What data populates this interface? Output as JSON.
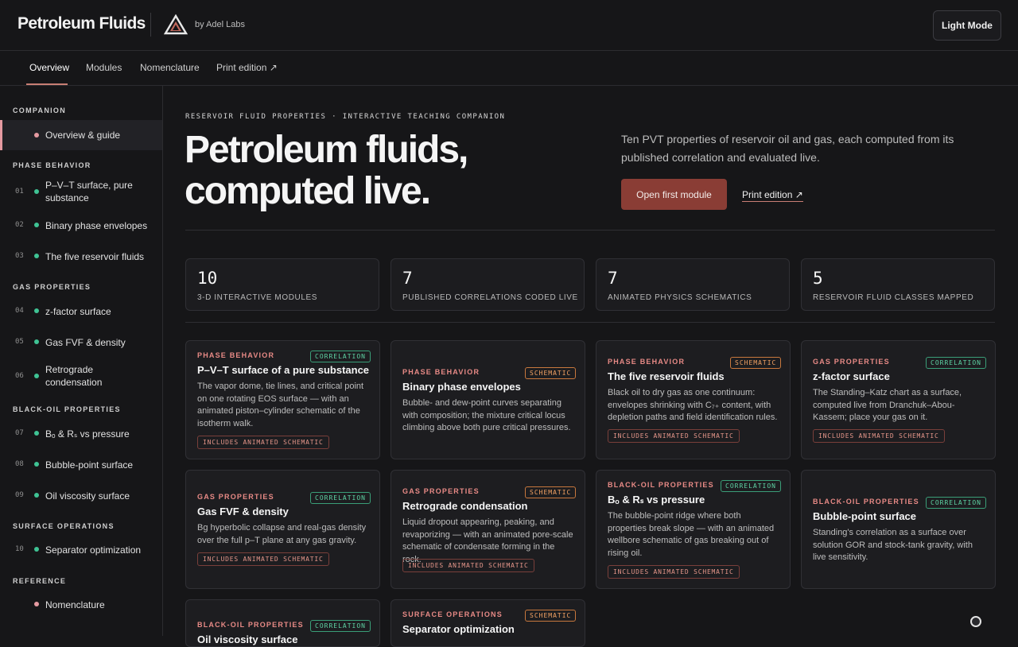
{
  "header": {
    "brand": "Petroleum Fluids",
    "byline": "by Adel Labs",
    "mode_button": "Light Mode"
  },
  "nav": {
    "items": [
      "Overview",
      "Modules",
      "Nomenclature",
      "Print edition ↗"
    ]
  },
  "sidebar": {
    "sections": {
      "companion": "COMPANION",
      "phase": "PHASE BEHAVIOR",
      "gas": "GAS PROPERTIES",
      "blackoil": "BLACK-OIL PROPERTIES",
      "surface": "SURFACE OPERATIONS",
      "reference": "REFERENCE"
    },
    "overview": "Overview & guide",
    "items": [
      {
        "num": "01",
        "label": "P–V–T surface, pure substance"
      },
      {
        "num": "02",
        "label": "Binary phase envelopes"
      },
      {
        "num": "03",
        "label": "The five reservoir fluids"
      },
      {
        "num": "04",
        "label": "z-factor surface"
      },
      {
        "num": "05",
        "label": "Gas FVF & density"
      },
      {
        "num": "06",
        "label": "Retrograde condensation"
      },
      {
        "num": "07",
        "label": "Bₒ & Rₛ vs pressure"
      },
      {
        "num": "08",
        "label": "Bubble-point surface"
      },
      {
        "num": "09",
        "label": "Oil viscosity surface"
      },
      {
        "num": "10",
        "label": "Separator optimization"
      }
    ],
    "nomenclature": "Nomenclature"
  },
  "hero": {
    "eyebrow": "RESERVOIR FLUID PROPERTIES · INTERACTIVE TEACHING COMPANION",
    "title_line1": "Petroleum fluids,",
    "title_line2": "computed live.",
    "description": "Ten PVT properties of reservoir oil and gas, each computed from its published correlation and evaluated live.",
    "primary_button": "Open first module",
    "print_link": "Print edition ↗"
  },
  "stats": [
    {
      "value": "10",
      "label": "3-D INTERACTIVE MODULES"
    },
    {
      "value": "7",
      "label": "PUBLISHED CORRELATIONS CODED LIVE"
    },
    {
      "value": "7",
      "label": "ANIMATED PHYSICS SCHEMATICS"
    },
    {
      "value": "5",
      "label": "RESERVOIR FLUID CLASSES MAPPED"
    }
  ],
  "badges": {
    "correlation": "CORRELATION",
    "schematic": "SCHEMATIC"
  },
  "anim_tag": "INCLUDES ANIMATED SCHEMATIC",
  "cards": [
    {
      "category": "PHASE BEHAVIOR",
      "title": "P–V–T surface of a pure substance",
      "desc": "The vapor dome, tie lines, and critical point on one rotating EOS surface — with an animated piston–cylinder schematic of the isotherm walk."
    },
    {
      "category": "PHASE BEHAVIOR",
      "title": "Binary phase envelopes",
      "desc": "Bubble- and dew-point curves separating with composition; the mixture critical locus climbing above both pure critical pressures."
    },
    {
      "category": "PHASE BEHAVIOR",
      "title": "The five reservoir fluids",
      "desc": "Black oil to dry gas as one continuum: envelopes shrinking with C₇₊ content, with depletion paths and field identification rules."
    },
    {
      "category": "GAS PROPERTIES",
      "title": "z-factor surface",
      "desc": "The Standing–Katz chart as a surface, computed live from Dranchuk–Abou-Kassem; place your gas on it."
    },
    {
      "category": "GAS PROPERTIES",
      "title": "Gas FVF & density",
      "desc": "Bg hyperbolic collapse and real-gas density over the full p–T plane at any gas gravity."
    },
    {
      "category": "GAS PROPERTIES",
      "title": "Retrograde condensation",
      "desc": "Liquid dropout appearing, peaking, and revaporizing — with an animated pore-scale schematic of condensate forming in the rock."
    },
    {
      "category": "BLACK-OIL PROPERTIES",
      "title": "Bₒ & Rₛ vs pressure",
      "desc": "The bubble-point ridge where both properties break slope — with an animated wellbore schematic of gas breaking out of rising oil."
    },
    {
      "category": "BLACK-OIL PROPERTIES",
      "title": "Bubble-point surface",
      "desc": "Standing's correlation as a surface over solution GOR and stock-tank gravity, with live sensitivity."
    },
    {
      "category": "BLACK-OIL PROPERTIES",
      "title": "Oil viscosity surface",
      "desc": ""
    },
    {
      "category": "SURFACE OPERATIONS",
      "title": "Separator optimization",
      "desc": ""
    }
  ]
}
